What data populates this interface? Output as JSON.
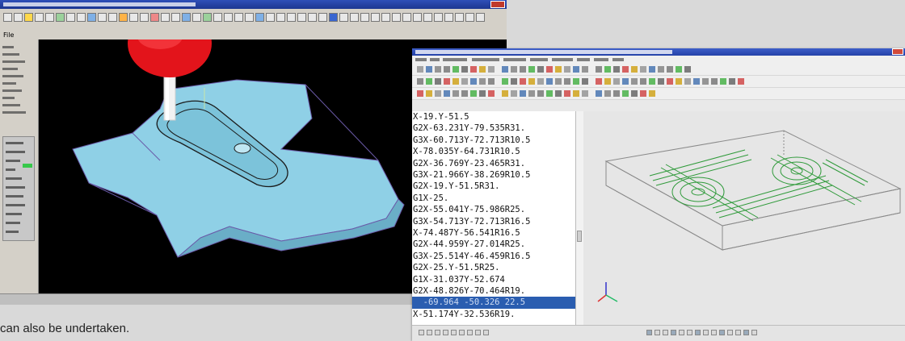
{
  "cam_window": {
    "menu": {
      "file_label": "File"
    },
    "colors": {
      "title_bar": "#2f4fb8",
      "viewport_bg": "#000000",
      "toolpath_surface": "#8fd0e6",
      "tool_head": "#e3141b",
      "status_indicator": "#37c84a"
    },
    "icons": [
      "tool-head",
      "toolpath-surface",
      "minimize-icon",
      "close-icon"
    ]
  },
  "editor_window": {
    "code_lines": [
      "X-19.Y-51.5",
      "G2X-63.231Y-79.535R31.",
      "G3X-60.713Y-72.713R10.5",
      "X-78.035Y-64.731R10.5",
      "G2X-36.769Y-23.465R31.",
      "G3X-21.966Y-38.269R10.5",
      "G2X-19.Y-51.5R31.",
      "G1X-25.",
      "G2X-55.041Y-75.986R25.",
      "G3X-54.713Y-72.713R16.5",
      "X-74.487Y-56.541R16.5",
      "G2X-44.959Y-27.014R25.",
      "G3X-25.514Y-46.459R16.5",
      "G2X-25.Y-51.5R25.",
      "G1X-31.037Y-52.674",
      "G2X-48.826Y-70.464R19.",
      "  -69.964 -50.326 22.5",
      "X-51.174Y-32.536R19."
    ],
    "selected_line_index": 16,
    "colors": {
      "title_bar": "#3d5ec9",
      "selection": "#2a5db0",
      "view_bg": "#e6e6e6",
      "toolpath": "#2f9a3a",
      "wireframe": "#8a8a8a",
      "axis_x": "#d33",
      "axis_y": "#2b6",
      "axis_z": "#33c"
    },
    "icons": [
      "close-icon",
      "save-icon",
      "open-icon",
      "axis-triad"
    ]
  },
  "caption": {
    "text": "can also be undertaken."
  }
}
